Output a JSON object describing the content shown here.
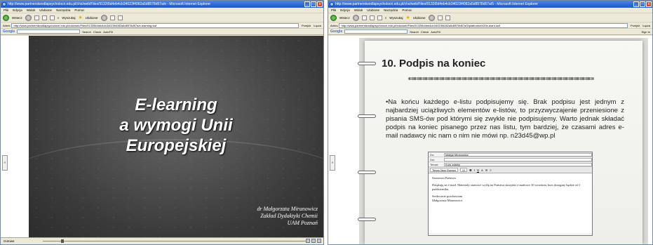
{
  "left_window": {
    "title": "http://www.partnerstwodlapsycholocri.edu.pl/chs/web/Files/9132t5d4eb4cb34023f4082a5d8578d57a/e - Microsoft Internet Explorer",
    "menu": [
      "Plik",
      "Edycja",
      "Widok",
      "Ulubione",
      "Narzędzia",
      "Pomoc"
    ],
    "nav": {
      "back": "Wstecz",
      "search": "Wyszukaj",
      "favorites": "Ulubione"
    },
    "address_label": "Adres",
    "address_url": "http://www.partnerstwodlapsycholocri.edu.pl/edu/web/Files/9132t5d4eb4cb34023f4082a5d8578d57a/e-learning.swf",
    "go": "Przejdź",
    "links": "Łącza",
    "google": {
      "logo": "Google",
      "search": "Search",
      "check": "Check",
      "autofill": "AutoFill"
    },
    "slide": {
      "title_lines": [
        "E-learning",
        "a wymogi Unii",
        "Europejskiej"
      ],
      "author_lines": [
        "dr Małgorzata Miranowicz",
        "Zakład Dydaktyki Chemii",
        "UAM Poznań"
      ]
    },
    "status": "Gotowe"
  },
  "right_window": {
    "title": "http://www.partnerstwodlapsycholocri.edu.pl/chs/web/Files/9132t5d4eb4cb34023f4082a5d8578d57a/5 - Microsoft Internet Explorer",
    "menu": [
      "Plik",
      "Edycja",
      "Widok",
      "Ulubione",
      "Narzędzia",
      "Pomoc"
    ],
    "nav": {
      "back": "Wstecz",
      "search": "Wyszukaj",
      "favorites": "Ulubione"
    },
    "address_label": "Adres",
    "address_url": "http://www.partnerstwodlapsycholocri.edu.pl/edu/web/Files/9132t5d4eb4cb34023f4082a5d8578d57a/5/platforma%20e-learn.swf",
    "go": "Przejdź",
    "links": "Łącza",
    "google": {
      "logo": "Google",
      "search": "Search",
      "check": "Check",
      "autofill": "AutoFill",
      "signin": "Sign In"
    },
    "slide": {
      "title": "10. Podpis na koniec",
      "body": "•Na końcu każdego e-listu podpisujemy się. Brak podpisu jest jednym z najbardziej uciążliwych elementów e-listów, to przyzwyczajenie przeniesione z pisania SMS-ów pod którymi się zwykle nie podpisujemy. Warto jednak składać podpis na koniec pisanego przez nas listu, tym bardziej, że czasami adres e-mail nadawcy nic nam o nim nie mówi np. n23d45@wp.pl",
      "mail": {
        "to_label": "Do:",
        "to_value": "Maliga Miranowicz",
        "cc_label": "Dw:",
        "cc_value": "",
        "subject_label": "Temat:",
        "subject_value": "Kurs zdalny",
        "font": "Times New Roman",
        "size": "12",
        "greeting": "Szanowni Państwo",
        "body": "Dziękuję za e-mail. Materiały startowe wyślę na Państwa skrzynki e-mailowe 30 września, kurs dostępny będzie od 1 października.",
        "closing": "Serdecznie pozdrawiam",
        "signature": "Małgorzata Miranowicz"
      }
    }
  }
}
